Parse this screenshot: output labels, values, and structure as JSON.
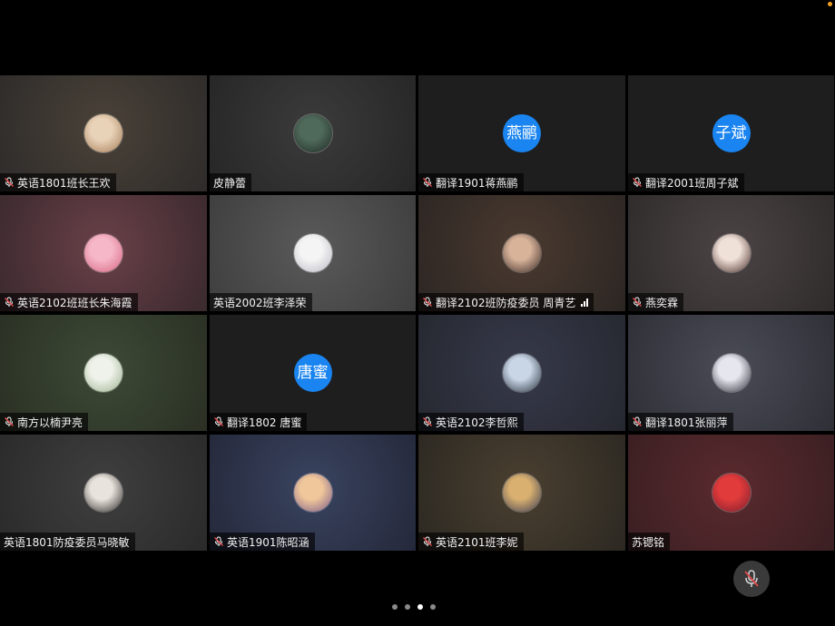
{
  "participants": [
    {
      "name": "英语1801班长王欢",
      "muted": true,
      "avatar": {
        "type": "photo",
        "colors": [
          "#e8d2b8",
          "#a57b55"
        ]
      },
      "bg": [
        "#4a4238",
        "#2e2b2a"
      ]
    },
    {
      "name": "皮静蕾",
      "muted": false,
      "avatar": {
        "type": "photo",
        "colors": [
          "#4f6a5a",
          "#1f2a25"
        ]
      },
      "bg": [
        "#3b3b3b",
        "#262626"
      ]
    },
    {
      "name": "翻译1901蒋燕鹂",
      "muted": true,
      "avatar": {
        "type": "text",
        "text": "燕鹂"
      },
      "bg": [
        "#1e1e1e",
        "#1e1e1e"
      ]
    },
    {
      "name": "翻译2001班周子斌",
      "muted": true,
      "avatar": {
        "type": "text",
        "text": "子斌"
      },
      "bg": [
        "#1e1e1e",
        "#1e1e1e"
      ]
    },
    {
      "name": "英语2102班班长朱海霞",
      "muted": true,
      "avatar": {
        "type": "photo",
        "colors": [
          "#f6b7c8",
          "#d56480"
        ]
      },
      "bg": [
        "#6a4048",
        "#3a2a2e"
      ]
    },
    {
      "name": "英语2002班李泽荣",
      "muted": false,
      "avatar": {
        "type": "photo",
        "colors": [
          "#f4f4f4",
          "#b9b9c4"
        ]
      },
      "bg": [
        "#5a5a5a",
        "#3e3e3e"
      ]
    },
    {
      "name": "翻译2102班防疫委员 周青艺",
      "muted": true,
      "signal": true,
      "avatar": {
        "type": "photo",
        "colors": [
          "#d8b39a",
          "#3b2a26"
        ]
      },
      "bg": [
        "#4a3a30",
        "#2c2623"
      ]
    },
    {
      "name": "燕奕霖",
      "muted": true,
      "avatar": {
        "type": "photo",
        "colors": [
          "#efe0d8",
          "#4a2f2a"
        ]
      },
      "bg": [
        "#4c4444",
        "#2f2b2b"
      ]
    },
    {
      "name": "南方以楠尹亮",
      "muted": true,
      "avatar": {
        "type": "photo",
        "colors": [
          "#eef2ea",
          "#9bb08b"
        ]
      },
      "bg": [
        "#3d4a36",
        "#2a3024"
      ]
    },
    {
      "name": "翻译1802 唐蜜",
      "muted": true,
      "avatar": {
        "type": "text",
        "text": "唐蜜"
      },
      "bg": [
        "#1e1e1e",
        "#1e1e1e"
      ]
    },
    {
      "name": "英语2102李哲熙",
      "muted": true,
      "avatar": {
        "type": "photo",
        "colors": [
          "#c9d6e6",
          "#29313d"
        ]
      },
      "bg": [
        "#36394a",
        "#262830"
      ]
    },
    {
      "name": "翻译1801张丽萍",
      "muted": true,
      "avatar": {
        "type": "photo",
        "colors": [
          "#e6e6ee",
          "#2c2c34"
        ]
      },
      "bg": [
        "#4a4c56",
        "#2e2f36"
      ]
    },
    {
      "name": "英语1801防疫委员马晓敏",
      "muted": false,
      "avatar": {
        "type": "photo",
        "colors": [
          "#e9e3dd",
          "#2e2a28"
        ]
      },
      "bg": [
        "#3f3f3f",
        "#2a2a2a"
      ]
    },
    {
      "name": "英语1901陈昭涵",
      "muted": true,
      "avatar": {
        "type": "photo",
        "colors": [
          "#f0c79a",
          "#7a5a8a"
        ]
      },
      "bg": [
        "#3a4460",
        "#24283a"
      ]
    },
    {
      "name": "英语2101班李妮",
      "muted": true,
      "avatar": {
        "type": "photo",
        "colors": [
          "#d9b070",
          "#3b3b52"
        ]
      },
      "bg": [
        "#4a4030",
        "#2c2822"
      ]
    },
    {
      "name": "苏锶铭",
      "muted": false,
      "avatar": {
        "type": "photo",
        "colors": [
          "#e23b3b",
          "#7a1e2e"
        ]
      },
      "bg": [
        "#5a2a2e",
        "#3a1f22"
      ]
    }
  ],
  "controls": {
    "mute_icon": "mic-muted-icon"
  },
  "pagination": {
    "total": 4,
    "active": 2
  },
  "colors": {
    "avatar_accent": "#1a84f0",
    "muted_mic": "#e04848"
  }
}
